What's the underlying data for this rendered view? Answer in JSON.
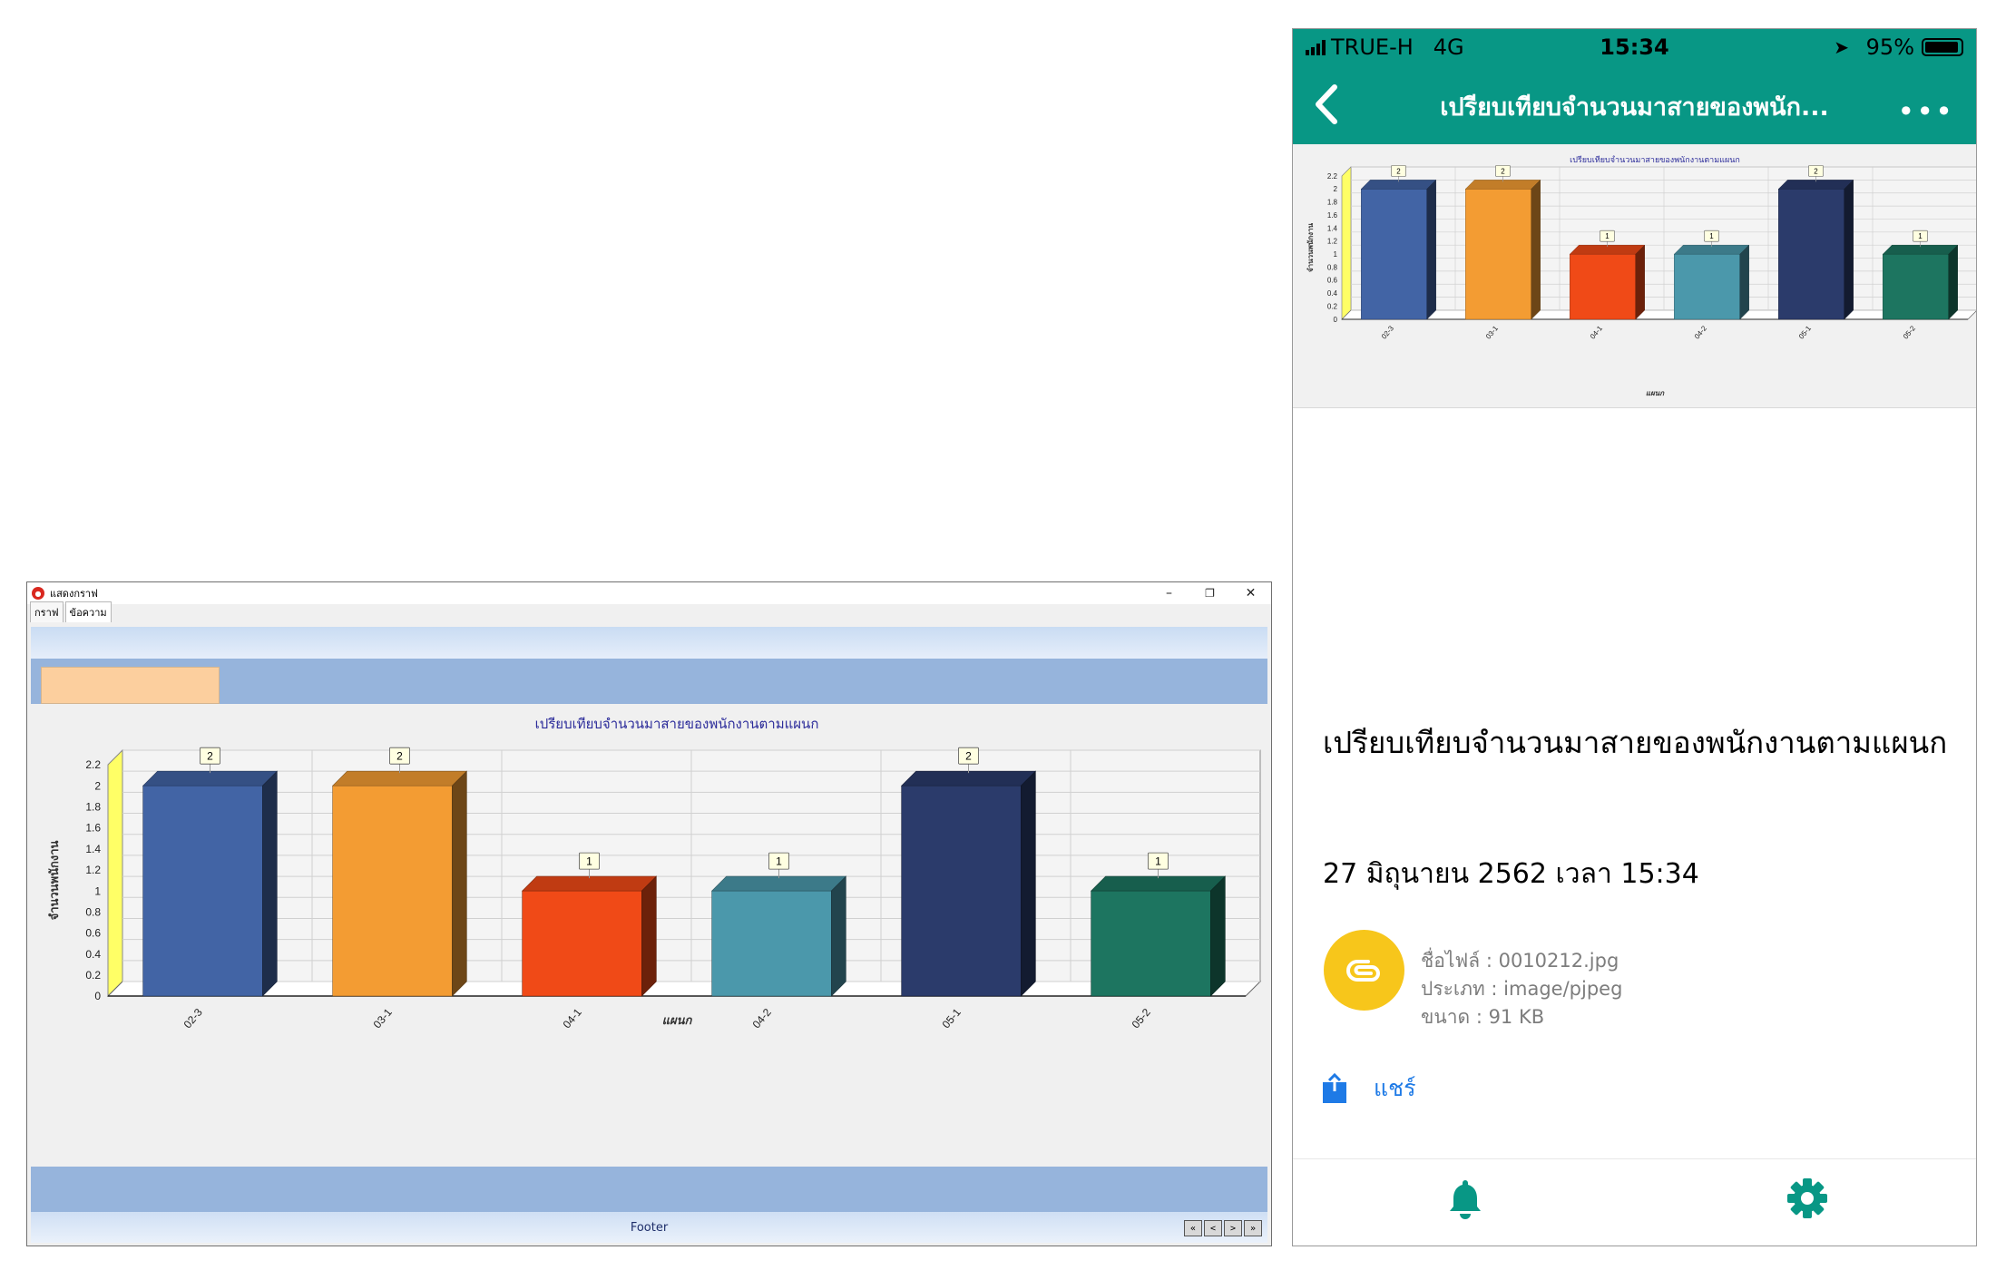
{
  "desktop_window": {
    "title": "แสดงกราฟ",
    "tabs": [
      "กราฟ",
      "ข้อความ"
    ],
    "controls": {
      "minimize": "–",
      "restore": "❐",
      "close": "✕"
    },
    "footer_label": "Footer",
    "nav_buttons": [
      "«",
      "<",
      ">",
      "»"
    ]
  },
  "phone": {
    "status": {
      "carrier": "TRUE-H",
      "network": "4G",
      "time": "15:34",
      "battery": "95%"
    },
    "nav_title": "เปรียบเทียบจำนวนมาสายของพนัก...",
    "more_label": "•••",
    "heading": "เปรียบเทียบจำนวนมาสายของพนักงานตามแผนก",
    "datetime": "27 มิถุนายน 2562 เวลา 15:34",
    "file": {
      "name_line": "ชื่อไฟล์ : 0010212.jpg",
      "type_line": "ประเภท : image/pjpeg",
      "size_line": "ขนาด : 91 KB"
    },
    "share_label": "แชร์",
    "icons": {
      "back": "chevron-left-icon",
      "attachment": "paperclip-icon",
      "share": "share-icon",
      "bell": "bell-icon",
      "gear": "gear-icon"
    },
    "accent_color": "#089785"
  },
  "chart_data": [
    {
      "type": "bar",
      "title": "เปรียบเทียบจำนวนมาสายของพนักงานตามแผนก",
      "xlabel": "แผนก",
      "ylabel": "จำนวนพนักงาน",
      "categories": [
        "02-3",
        "03-1",
        "04-1",
        "04-2",
        "05-1",
        "05-2"
      ],
      "values": [
        2,
        2,
        1,
        1,
        2,
        1
      ],
      "ylim": [
        0,
        2.2
      ],
      "yticks": [
        "0",
        "0.2",
        "0.4",
        "0.6",
        "0.8",
        "1",
        "1.2",
        "1.4",
        "1.6",
        "1.8",
        "2",
        "2.2"
      ],
      "bar_colors": [
        "#4264a5",
        "#f39c33",
        "#f04a17",
        "#4b98ab",
        "#2b3b6b",
        "#1d7560"
      ],
      "grid": true,
      "style": "3d"
    }
  ]
}
